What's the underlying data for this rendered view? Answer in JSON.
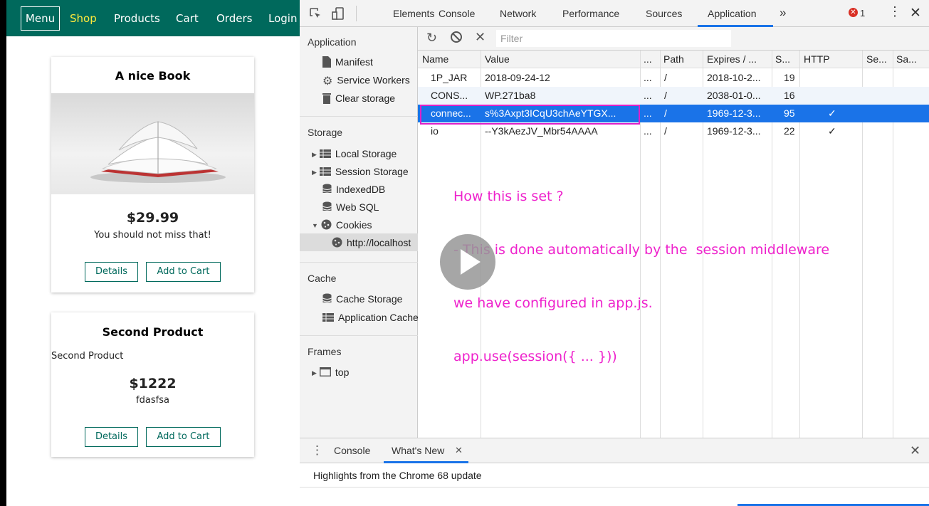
{
  "shop": {
    "nav": {
      "menu": "Menu",
      "shop": "Shop",
      "products": "Products",
      "cart": "Cart",
      "orders": "Orders",
      "login": "Login"
    },
    "products": [
      {
        "title": "A nice Book",
        "price": "$29.99",
        "description": "You should not miss that!",
        "details": "Details",
        "add_to_cart": "Add to Cart"
      },
      {
        "title": "Second Product",
        "image_alt": "Second Product",
        "price": "$1222",
        "description": "fdasfsa",
        "details": "Details",
        "add_to_cart": "Add to Cart"
      }
    ]
  },
  "devtools": {
    "tabs": [
      "Elements",
      "Console",
      "Network",
      "Performance",
      "Sources",
      "Application"
    ],
    "active_tab": "Application",
    "more_tabs": "»",
    "error_count": "1",
    "sidebar": {
      "application_head": "Application",
      "application_items": [
        "Manifest",
        "Service Workers",
        "Clear storage"
      ],
      "storage_head": "Storage",
      "storage_items": [
        "Local Storage",
        "Session Storage",
        "IndexedDB",
        "Web SQL",
        "Cookies"
      ],
      "cookie_origin": "http://localhost",
      "cache_head": "Cache",
      "cache_items": [
        "Cache Storage",
        "Application Cache"
      ],
      "frames_head": "Frames",
      "frames_items": [
        "top"
      ]
    },
    "filter_placeholder": "Filter",
    "columns": [
      "Name",
      "Value",
      "...",
      "Path",
      "Expires / ...",
      "S...",
      "HTTP",
      "Se...",
      "Sa..."
    ],
    "rows": [
      {
        "name": "1P_JAR",
        "value": "2018-09-24-12",
        "dots": "...",
        "path": "/",
        "expires": "2018-10-2...",
        "size": "19",
        "http": ""
      },
      {
        "name": "CONS...",
        "value": "WP.271ba8",
        "dots": "...",
        "path": "/",
        "expires": "2038-01-0...",
        "size": "16",
        "http": ""
      },
      {
        "name": "connec...",
        "value": "s%3Axpt3ICqU3chAeYTGX...",
        "dots": "...",
        "path": "/",
        "expires": "1969-12-3...",
        "size": "95",
        "http": "✓"
      },
      {
        "name": "io",
        "value": "--Y3kAezJV_Mbr54AAAA",
        "dots": "...",
        "path": "/",
        "expires": "1969-12-3...",
        "size": "22",
        "http": "✓"
      }
    ],
    "selected_row": 2,
    "drawer": {
      "tabs": [
        "Console",
        "What's New"
      ],
      "active_tab": "What's New",
      "highlight": "Highlights from the Chrome 68 update"
    }
  },
  "annotation": {
    "lines": [
      "How this is set ?",
      "- This is done automatically by the  session middleware",
      "we have configured in app.js.",
      "app.use(session({ ... }))"
    ],
    "color": "#ee22cc"
  },
  "colors": {
    "nav_bg": "#00695c",
    "nav_active": "#ffeb3b",
    "selection": "#1a73e8",
    "accent_tab": "#1a73e8"
  }
}
